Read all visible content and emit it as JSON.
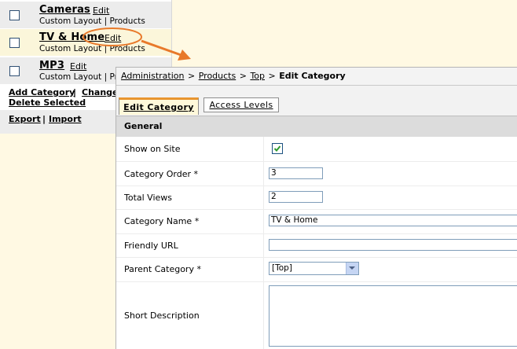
{
  "category_list": {
    "rows": [
      {
        "name": "Cameras",
        "edit": "Edit",
        "sub": "Custom Layout | Products"
      },
      {
        "name": "TV & Home",
        "edit": "Edit",
        "sub": "Custom Layout | Products"
      },
      {
        "name": "MP3",
        "edit": "Edit",
        "sub": "Custom Layout | Pro"
      }
    ],
    "actions": {
      "add_category": "Add Category",
      "sep": "|",
      "change": "Change",
      "delete_selected": "Delete Selected",
      "export": "Export",
      "import": "Import"
    }
  },
  "callout": {
    "highlight_color": "#e8792a"
  },
  "panel": {
    "breadcrumb": {
      "items": [
        "Administration",
        "Products",
        "Top"
      ],
      "sep": ">",
      "current": "Edit Category"
    },
    "tabs": [
      {
        "label": "Edit Category",
        "active": true
      },
      {
        "label": "Access Levels",
        "active": false
      }
    ],
    "section_title": "General",
    "fields": {
      "show_on_site": {
        "label": "Show on Site",
        "checked": true
      },
      "category_order": {
        "label": "Category Order *",
        "value": "3"
      },
      "total_views": {
        "label": "Total Views",
        "value": "2"
      },
      "category_name": {
        "label": "Category Name *",
        "value": "TV & Home"
      },
      "friendly_url": {
        "label": "Friendly URL",
        "value": ""
      },
      "parent_category": {
        "label": "Parent Category *",
        "value": "[Top]"
      },
      "short_description": {
        "label": "Short Description",
        "value": ""
      }
    }
  },
  "colors": {
    "background": "#fff9e3",
    "accent_orange": "#e8792a",
    "checkbox_green": "#2e9a2e"
  }
}
